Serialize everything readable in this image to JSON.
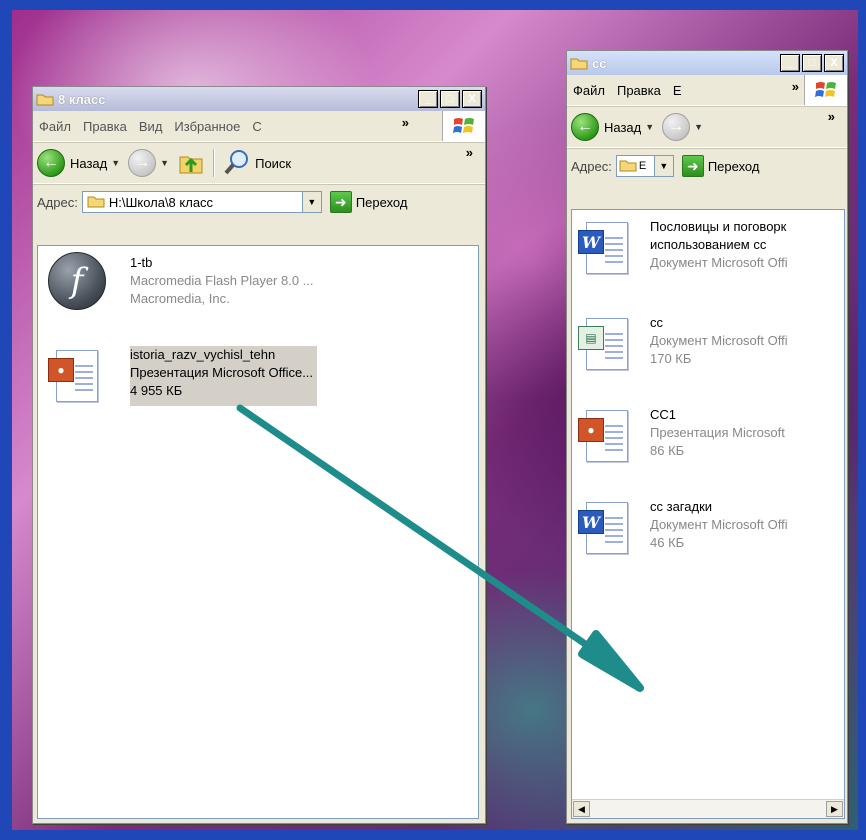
{
  "left_window": {
    "title": "8 класс",
    "controls": [
      "_",
      "□",
      "X"
    ],
    "menu": [
      "Файл",
      "Правка",
      "Вид",
      "Избранное",
      "С"
    ],
    "chevron": "»",
    "toolbar": {
      "back": "Назад",
      "search": "Поиск"
    },
    "address": {
      "label": "Адрес:",
      "value": "H:\\Школа\\8 класс",
      "go": "Переход"
    },
    "files": [
      {
        "name": "1-tb",
        "line2": "Macromedia Flash Player 8.0 ...",
        "line3": "Macromedia, Inc.",
        "icon": "flash-icon",
        "selected": false
      },
      {
        "name": "istoria_razv_vychisl_tehn",
        "line2": "Презентация Microsoft Office...",
        "line3": "4 955 КБ",
        "icon": "powerpoint-icon",
        "selected": true
      }
    ]
  },
  "right_window": {
    "title": "cc",
    "controls": [
      "_",
      "□",
      "X"
    ],
    "menu": [
      "Файл",
      "Правка",
      "Е"
    ],
    "chevron": "»",
    "toolbar": {
      "back": "Назад"
    },
    "address": {
      "label": "Адрес:",
      "value": "E",
      "go": "Переход"
    },
    "files": [
      {
        "name": "Пословицы и поговорк",
        "line2": "использованием сс",
        "line3": "Документ Microsoft Offi",
        "icon": "word-icon"
      },
      {
        "name": "cc",
        "line2": "Документ Microsoft Offi",
        "line3": "170 КБ",
        "icon": "publisher-icon"
      },
      {
        "name": "CC1",
        "line2": "Презентация Microsoft",
        "line3": "86 КБ",
        "icon": "powerpoint-icon"
      },
      {
        "name": "сс загадки",
        "line2": "Документ Microsoft Offi",
        "line3": "46 КБ",
        "icon": "word-icon"
      }
    ]
  },
  "colors": {
    "arrow": "#1f8c8c",
    "selection": "#d4d0c8"
  }
}
